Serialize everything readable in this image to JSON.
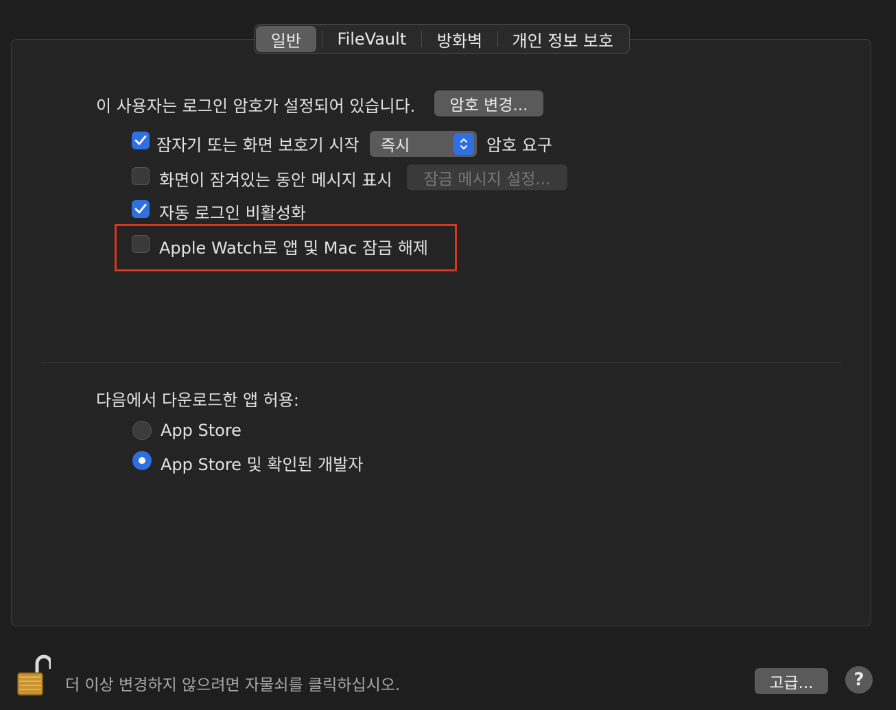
{
  "tabs": [
    {
      "label": "일반",
      "active": true
    },
    {
      "label": "FileVault",
      "active": false
    },
    {
      "label": "방화벽",
      "active": false
    },
    {
      "label": "개인 정보 보호",
      "active": false
    }
  ],
  "general": {
    "password_status": "이 사용자는 로그인 암호가 설정되어 있습니다.",
    "change_password_button": "암호 변경...",
    "require_password": {
      "checked": true,
      "label": "잠자기 또는 화면 보호기 시작",
      "popup_value": "즉시",
      "suffix": "암호 요구"
    },
    "show_message": {
      "checked": false,
      "label": "화면이 잠겨있는 동안 메시지 표시",
      "button": "잠금 메시지 설정..."
    },
    "disable_auto_login": {
      "checked": true,
      "label": "자동 로그인 비활성화"
    },
    "apple_watch_unlock": {
      "checked": false,
      "label": "Apple Watch로 앱 및 Mac 잠금 해제"
    }
  },
  "downloads": {
    "heading": "다음에서 다운로드한 앱 허용:",
    "options": [
      {
        "label": "App Store",
        "selected": false
      },
      {
        "label": "App Store 및 확인된 개발자",
        "selected": true
      }
    ]
  },
  "footer": {
    "lock_text": "더 이상 변경하지 않으려면 자물쇠를 클릭하십시오.",
    "advanced_button": "고급...",
    "help_button": "?"
  },
  "colors": {
    "accent": "#2f6fe0",
    "highlight": "#d8361d"
  }
}
